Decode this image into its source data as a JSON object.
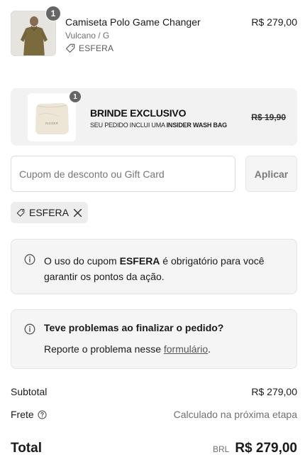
{
  "product": {
    "quantity": "1",
    "title": "Camiseta Polo Game Changer",
    "variant": "Vulcano / G",
    "discount_tag": "ESFERA",
    "price": "R$ 279,00"
  },
  "gift": {
    "quantity": "1",
    "title": "BRINDE EXCLUSIVO",
    "subtitle_prefix": "SEU PEDIDO INCLUI UMA ",
    "subtitle_bold": "INSIDER WASH BAG",
    "original_price": "R$ 19,90",
    "bag_print": "INSIDER"
  },
  "coupon": {
    "placeholder": "Cupom de desconto ou Gift Card",
    "value": "",
    "apply_label": "Aplicar",
    "applied_code": "ESFERA"
  },
  "notices": {
    "required": {
      "prefix": "O uso do cupom ",
      "code": "ESFERA",
      "suffix": " é obrigatório para você garantir os pontos da ação."
    },
    "problem": {
      "title": "Teve problemas ao finalizar o pedido?",
      "body_prefix": "Reporte o problema nesse ",
      "link": "formulário",
      "body_suffix": "."
    }
  },
  "summary": {
    "subtotal_label": "Subtotal",
    "subtotal_value": "R$ 279,00",
    "shipping_label": "Frete",
    "shipping_value": "Calculado na próxima etapa",
    "total_label": "Total",
    "currency_code": "BRL",
    "total_value": "R$ 279,00"
  },
  "icons": {
    "tag": "tag-icon",
    "close": "close-icon",
    "info": "info-icon",
    "help": "question-circle-icon"
  },
  "colors": {
    "badge": "#666666",
    "panel": "#f5f5f5",
    "gift_panel": "#f2f2f2",
    "muted_text": "#707070"
  }
}
